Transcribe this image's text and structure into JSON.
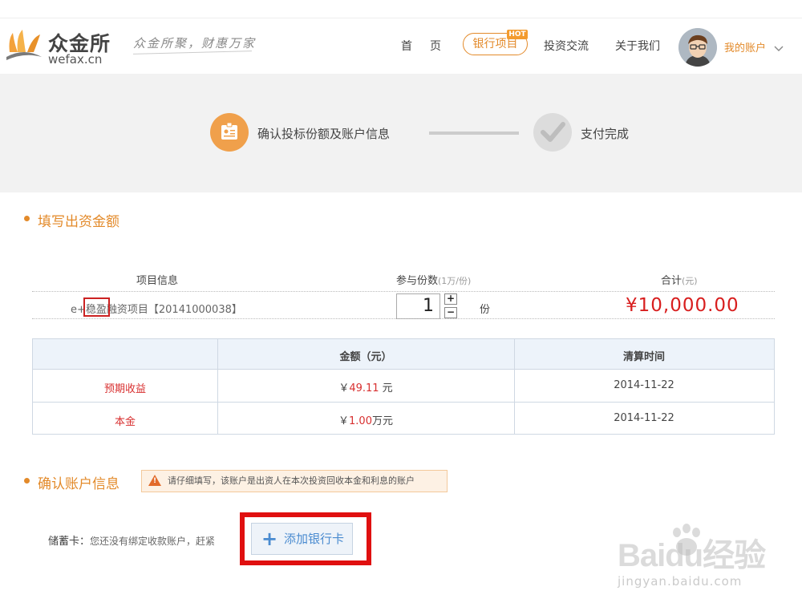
{
  "header": {
    "brand_cn": "众金所",
    "brand_en": "wefax.cn",
    "slogan": "众金所聚，财惠万家",
    "nav": {
      "home": "首页",
      "bank": "银行项目",
      "hot_badge": "HOT",
      "invest": "投资交流",
      "about": "关于我们"
    },
    "account": "我的账户",
    "account_chevron": "chevron-down-icon"
  },
  "progress": {
    "step1": "确认投标份额及账户信息",
    "step2": "支付完成"
  },
  "fill_section": {
    "title": "填写出资金额",
    "col_project": "项目信息",
    "col_shares": "参与份数",
    "col_shares_unit": "(1万/份)",
    "col_total": "合计",
    "col_total_unit": "(元)",
    "project_name": "e+稳盈融资项目【20141000038】",
    "quantity": "1",
    "plus": "+",
    "minus": "−",
    "unit": "份",
    "total": "¥10,000.00"
  },
  "table": {
    "headers": [
      "",
      "金额（元）",
      "清算时间"
    ],
    "rows": [
      {
        "label": "预期收益",
        "prefix": "￥",
        "amount": "49.11",
        "suffix": " 元",
        "date": "2014-11-22"
      },
      {
        "label": "本金",
        "prefix": "￥",
        "amount": "1.00",
        "suffix": "万元",
        "date": "2014-11-22"
      }
    ]
  },
  "account_section": {
    "title": "确认账户信息",
    "warning_icon": "warning-icon",
    "warning": "请仔细填写，该账户是出资人在本次投资回收本金和利息的账户",
    "card_label": "储蓄卡：",
    "card_text": "您还没有绑定收款账户，赶紧",
    "add_card": "添加银行卡"
  },
  "watermark": {
    "text": "Baidu经验",
    "url": "jingyan.baidu.com"
  },
  "colors": {
    "accent": "#e38a2a",
    "price": "#d81e1e",
    "highlight_box": "#e01010"
  }
}
